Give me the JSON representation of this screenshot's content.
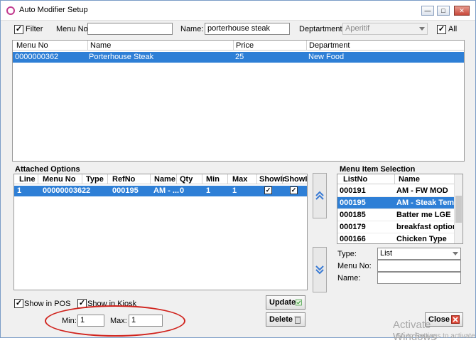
{
  "window": {
    "title": "Auto Modifier Setup"
  },
  "filter": {
    "filter_label": "Filter",
    "filter_checked": true,
    "menu_no_label": "Menu No:",
    "menu_no_value": "",
    "name_label": "Name:",
    "name_value": "porterhouse steak",
    "department_label": "Deptartment:",
    "department_value": "Aperitif",
    "all_label": "All",
    "all_checked": true
  },
  "top_grid": {
    "columns": [
      "Menu No",
      "Name",
      "Price",
      "Department"
    ],
    "rows": [
      {
        "menu_no": "0000000362",
        "name": "Porterhouse Steak",
        "price": "25",
        "department": "New Food"
      }
    ]
  },
  "attached_options": {
    "title": "Attached Options",
    "columns": [
      "Line",
      "Menu No",
      "Type",
      "RefNo",
      "Name",
      "Qty",
      "Min",
      "Max",
      "ShowIr",
      "ShowIr"
    ],
    "rows": [
      {
        "line": "1",
        "menu_no": "0000000362",
        "type": "2",
        "refno": "000195",
        "name": "AM - ...",
        "qty": "0",
        "min": "1",
        "max": "1",
        "show_pos": true,
        "show_kiosk": true
      }
    ]
  },
  "menu_item_selection": {
    "title": "Menu Item Selection",
    "columns": [
      "ListNo",
      "Name"
    ],
    "rows": [
      {
        "listno": "000191",
        "name": "AM - FW MOD"
      },
      {
        "listno": "000195",
        "name": "AM - Steak Temp"
      },
      {
        "listno": "000185",
        "name": "Batter me LGE"
      },
      {
        "listno": "000179",
        "name": "breakfast options"
      },
      {
        "listno": "000166",
        "name": "Chicken Type"
      }
    ],
    "selected_index": 1,
    "type_label": "Type:",
    "type_value": "List",
    "menu_no_label": "Menu No:",
    "menu_no_value": "",
    "name_label": "Name:",
    "name_value": ""
  },
  "bottom": {
    "show_pos_label": "Show in POS",
    "show_pos_checked": true,
    "show_kiosk_label": "Show in Kiosk",
    "show_kiosk_checked": true,
    "min_label": "Min:",
    "min_value": "1",
    "max_label": "Max:",
    "max_value": "1",
    "update_label": "Update",
    "delete_label": "Delete",
    "close_label": "Close"
  },
  "watermark": {
    "line1": "Activate Windows",
    "line2": "Go to Settings to activate"
  },
  "colors": {
    "selection": "#2e7fd6",
    "annotation": "#d0231d"
  }
}
